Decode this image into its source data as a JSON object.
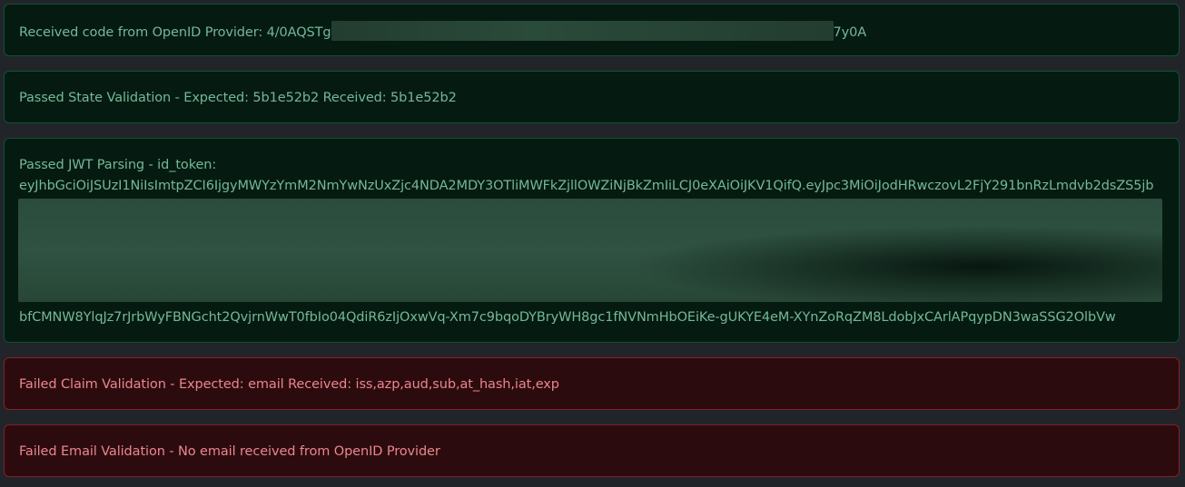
{
  "alerts": {
    "code": {
      "prefix": "Received code from OpenID Provider: 4/0AQSTg",
      "suffix": "7y0A"
    },
    "state": {
      "text": "Passed State Validation - Expected: 5b1e52b2 Received: 5b1e52b2"
    },
    "jwt": {
      "label": "Passed JWT Parsing - id_token:",
      "token_start": "eyJhbGciOiJSUzI1NiIsImtpZCI6IjgyMWYzYmM2NmYwNzUxZjc4NDA2MDY3OTliMWFkZjllOWZiNjBkZmIiLCJ0eXAiOiJKV1QifQ.eyJpc3MiOiJodHRwczovL2FjY291bnRzLmdvb2dsZS5jb",
      "token_end": "bfCMNW8YlqJz7rJrbWyFBNGcht2QvjrnWwT0fbIo04QdiR6zIjOxwVq-Xm7c9bqoDYBryWH8gc1fNVNmHbOEiKe-gUKYE4eM-XYnZoRqZM8LdobJxCArlAPqypDN3waSSG2OlbVw"
    },
    "claim": {
      "text": "Failed Claim Validation - Expected: email Received: iss,azp,aud,sub,at_hash,iat,exp"
    },
    "email": {
      "text": "Failed Email Validation - No email received from OpenID Provider"
    }
  },
  "colors": {
    "page_bg": "#212529",
    "success_bg": "#051b11",
    "success_border": "#0f5132",
    "success_text": "#75b798",
    "danger_bg": "#2c0b0e",
    "danger_border": "#842029",
    "danger_text": "#ea868f"
  }
}
